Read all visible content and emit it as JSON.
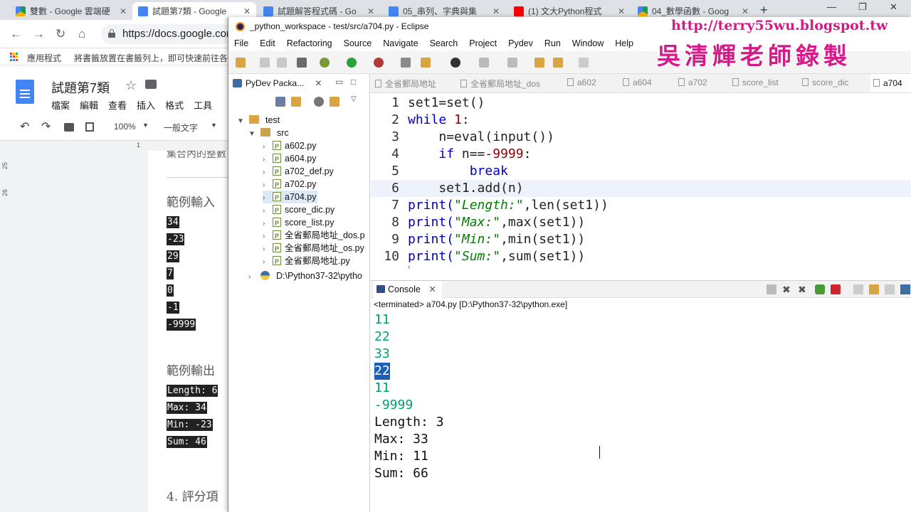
{
  "browser": {
    "tabs": [
      {
        "title": "雙數 - Google 雲端硬",
        "icon": "drive"
      },
      {
        "title": "試題第7類 - Google ",
        "icon": "docs"
      },
      {
        "title": "試題解答程式碼 - Go",
        "icon": "docs"
      },
      {
        "title": "05_串列、字典與集",
        "icon": "docs"
      },
      {
        "title": "(1) 文大Python程式",
        "icon": "youtube"
      },
      {
        "title": "04_數學函數 - Goog",
        "icon": "drive"
      }
    ],
    "tab_close": "✕",
    "new_tab": "+",
    "url": "https://docs.google.com",
    "bookmarks": {
      "apps_label": "應用程式",
      "hint": "將書籤放置在書籤列上，即可快速前往各"
    }
  },
  "docs": {
    "title": "試題第7類",
    "menu": [
      "檔案",
      "編輯",
      "查看",
      "插入",
      "格式",
      "工具"
    ],
    "zoom": "100%",
    "style": "一般文字",
    "ruler": "1",
    "vruler": [
      "25",
      "26"
    ],
    "cut_text": "集合內的整數",
    "sample_input_heading": "範例輸入",
    "sample_input": [
      "34",
      "-23",
      "29",
      "7",
      "0",
      "-1",
      "-9999"
    ],
    "sample_output_heading": "範例輸出",
    "sample_output": [
      "Length: 6",
      "Max: 34",
      "Min: -23",
      "Sum: 46"
    ],
    "next_section": "4.  評分項"
  },
  "eclipse": {
    "title": "_python_workspace - test/src/a704.py - Eclipse",
    "menu": [
      "File",
      "Edit",
      "Refactoring",
      "Source",
      "Navigate",
      "Search",
      "Project",
      "Pydev",
      "Run",
      "Window",
      "Help"
    ],
    "watermark_url": "http://terry55wu.blogspot.tw",
    "watermark_name": "吳清輝老師錄製",
    "explorer": {
      "tab": "PyDev Packa...",
      "project": "test",
      "src": "src",
      "files": [
        "a602.py",
        "a604.py",
        "a702_def.py",
        "a702.py",
        "a704.py",
        "score_dic.py",
        "score_list.py",
        "全省郵局地址_dos.p",
        "全省郵局地址_os.py",
        "全省郵局地址.py"
      ],
      "interpreter": "D:\\Python37-32\\pytho"
    },
    "editor_tabs": [
      "全省郵局地址",
      "全省郵局地址_dos",
      "a602",
      "a604",
      "a702",
      "score_list",
      "score_dic",
      "a704"
    ],
    "code": {
      "numbers": [
        "1",
        "2",
        "3",
        "4",
        "5",
        "6",
        "7",
        "8",
        "9",
        "10"
      ],
      "l1": "set1=set()",
      "l2_kw": "while",
      "l2_num": "1",
      "l2_rest": ":",
      "l3": "    n=eval(input())",
      "l4_kw": "if",
      "l4_a": " n==",
      "l4_num": "-9999",
      "l4_b": ":",
      "l5_kw": "break",
      "l6": "    set1.add(n)",
      "p_print": "print(",
      "l7_str": "\"Length:\"",
      "l7_rest": ",len(set1))",
      "l8_str": "\"Max:\"",
      "l8_rest": ",max(set1))",
      "l9_str": "\"Min:\"",
      "l9_rest": ",min(set1))",
      "l10_str": "\"Sum:\"",
      "l10_rest": ",sum(set1))"
    },
    "console": {
      "tab": "Console",
      "status": "<terminated> a704.py [D:\\Python37-32\\python.exe]",
      "inputs": [
        "11",
        "22",
        "33",
        "22",
        "11",
        "-9999"
      ],
      "outputs": [
        "Length: 3",
        "Max: 33",
        "Min: 11",
        "Sum: 66"
      ]
    }
  }
}
